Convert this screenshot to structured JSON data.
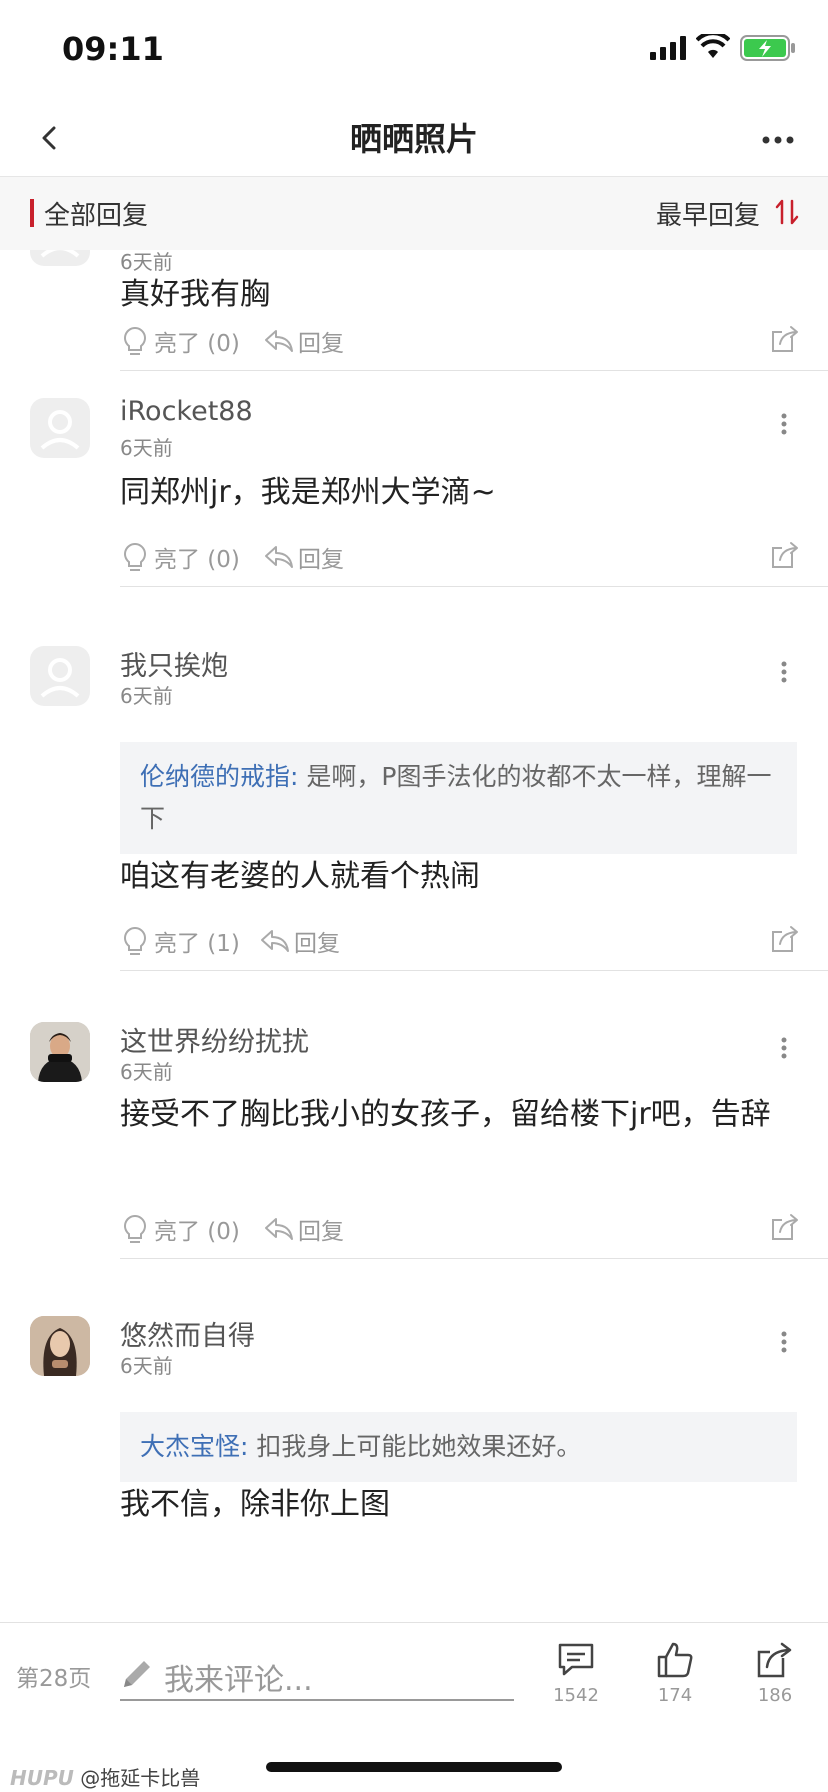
{
  "status_bar": {
    "time": "09:11"
  },
  "nav": {
    "title": "晒晒照片"
  },
  "subheader": {
    "all_replies": "全部回复",
    "sort_label": "最早回复"
  },
  "posts": [
    {
      "time_ago": "6天前",
      "content": "真好我有胸",
      "likes": "亮了 (0)",
      "reply": "回复"
    },
    {
      "username": "iRocket88",
      "time_ago": "6天前",
      "content": "同郑州jr，我是郑州大学滴~",
      "likes": "亮了 (0)",
      "reply": "回复"
    },
    {
      "username": "我只挨炮",
      "time_ago": "6天前",
      "quote_author": "伦纳德的戒指:",
      "quote_text": " 是啊，P图手法化的妆都不太一样，理解一下",
      "content": "咱这有老婆的人就看个热闹",
      "likes": "亮了 (1)",
      "reply": "回复"
    },
    {
      "username": "这世界纷纷扰扰",
      "time_ago": "6天前",
      "content": "接受不了胸比我小的女孩子，留给楼下jr吧，告辞",
      "likes": "亮了 (0)",
      "reply": "回复"
    },
    {
      "username": "悠然而自得",
      "time_ago": "6天前",
      "quote_author": "大杰宝怪:",
      "quote_text": " 扣我身上可能比她效果还好。",
      "content": "我不信，除非你上图"
    }
  ],
  "bottom_bar": {
    "page": "第28页",
    "comment_placeholder": "我来评论...",
    "comments_count": "1542",
    "likes_count": "174",
    "shares_count": "186"
  },
  "watermark": {
    "brand": "HUPU",
    "user": "@拖延卡比兽"
  },
  "colors": {
    "accent": "#c8202c",
    "quote_author": "#3e6fb5"
  }
}
